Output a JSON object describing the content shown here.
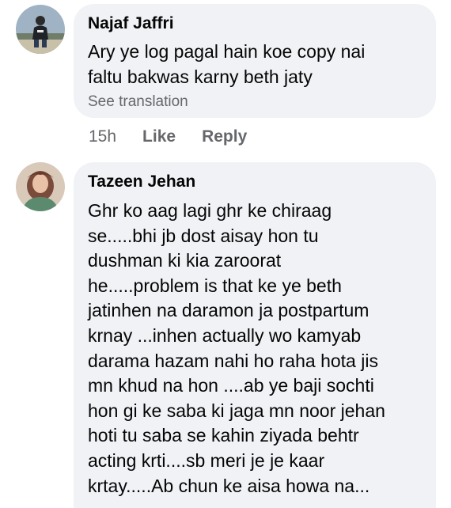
{
  "comments": [
    {
      "author": "Najaf Jaffri",
      "lines": [
        "Ary ye log pagal hain koe copy nai",
        "faltu bakwas karny beth jaty"
      ],
      "see_translation": "See translation",
      "time": "15h",
      "like_label": "Like",
      "reply_label": "Reply"
    },
    {
      "author": "Tazeen Jehan",
      "lines": [
        "Ghr ko aag lagi ghr ke chiraag",
        "se.....bhi jb dost aisay hon tu",
        "dushman ki kia zaroorat",
        "he.....problem is that ke ye beth",
        "jatinhen na daramon ja postpartum",
        "krnay ...inhen actually wo kamyab",
        "darama hazam nahi ho raha hota jis",
        "mn khud na hon ....ab ye baji sochti",
        "hon gi ke saba ki jaga mn noor jehan",
        "hoti tu saba se kahin ziyada behtr",
        "acting krti....sb meri je je kaar",
        "krtay.....Ab chun ke aisa howa na..."
      ]
    }
  ]
}
